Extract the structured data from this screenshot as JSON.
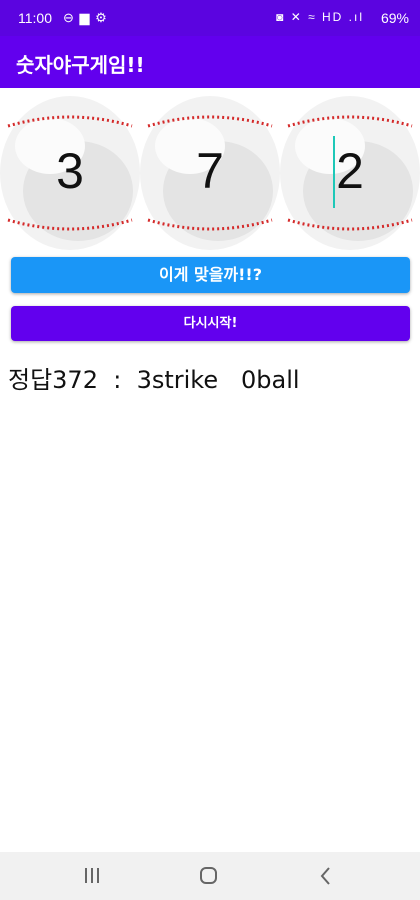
{
  "status_bar": {
    "time": "11:00",
    "left_icons": "⊖ ▆ ⚙",
    "right_icons": "◙ ✕ ≈ HD .ıl",
    "battery": "69%",
    "battery_icon": "battery-icon"
  },
  "app_bar": {
    "title": "숫자야구게임!!"
  },
  "balls": [
    {
      "digit": "3"
    },
    {
      "digit": "7"
    },
    {
      "digit": "2"
    }
  ],
  "buttons": {
    "check_label": "이게 맞을까!!?",
    "restart_label": "다시시작!"
  },
  "result_text": "정답372  :  3strike   0ball",
  "colors": {
    "status_bar": "#5b04e0",
    "app_bar": "#6200ee",
    "check_button": "#1a96f7",
    "restart_button": "#6200ee",
    "stitch": "#d42a2a"
  },
  "nav_bar": {
    "icons": [
      "recent-apps-icon",
      "home-icon",
      "back-icon"
    ]
  }
}
